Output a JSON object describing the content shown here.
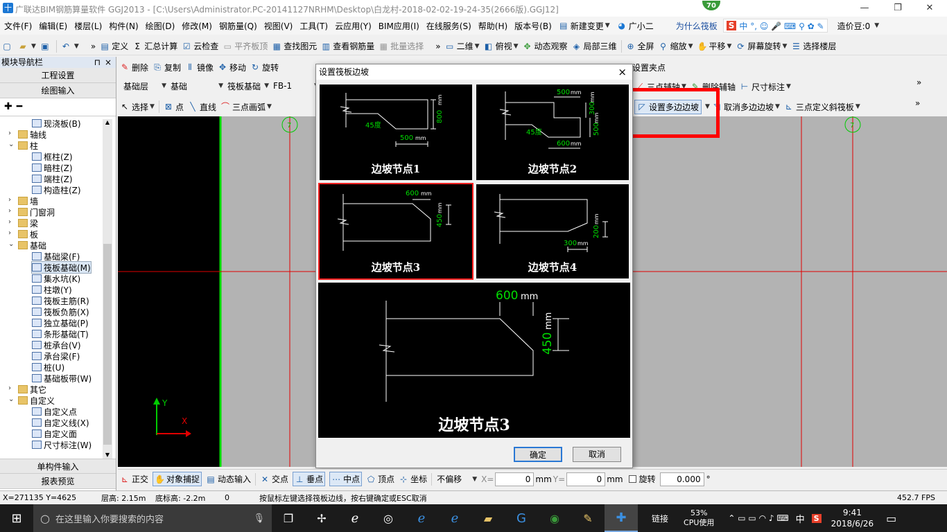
{
  "window": {
    "title": "广联达BIM钢筋算量软件 GGJ2013 - [C:\\Users\\Administrator.PC-20141127NRHM\\Desktop\\白龙村-2018-02-02-19-24-35(2666版).GGJ12]",
    "badge": "70"
  },
  "menu": [
    "文件(F)",
    "编辑(E)",
    "楼层(L)",
    "构件(N)",
    "绘图(D)",
    "修改(M)",
    "钢筋量(Q)",
    "视图(V)",
    "工具(T)",
    "云应用(Y)",
    "BIM应用(I)",
    "在线服务(S)",
    "帮助(H)",
    "版本号(B)",
    "新建变更",
    "广小二"
  ],
  "menu_right": {
    "question": "为什么筏板",
    "cost": "造价豆:0"
  },
  "toolbar1": {
    "items": [
      "定义",
      "汇总计算",
      "云检查",
      "平齐板顶",
      "查找图元",
      "查看钢筋量",
      "批量选择",
      "二维",
      "俯视",
      "动态观察",
      "局部三维",
      "全屏",
      "缩放",
      "平移",
      "屏幕旋转",
      "选择楼层"
    ]
  },
  "toolbar2": {
    "items": [
      "删除",
      "复制",
      "镜像",
      "移动",
      "旋转"
    ],
    "right_item": "设置夹点"
  },
  "toolbar3": {
    "floor": "基础层",
    "category": "基础",
    "type": "筏板基础",
    "name": "FB-1",
    "right_items": [
      "三点辅轴",
      "删除辅轴",
      "尺寸标注"
    ]
  },
  "toolbar4": {
    "items": [
      "选择",
      "点",
      "直线",
      "三点画弧"
    ],
    "right_items": [
      "设置多边边坡",
      "取消多边边坡",
      "三点定义斜筏板"
    ]
  },
  "leftpane": {
    "header": "模块导航栏",
    "pin": "⊓",
    "close": "×",
    "btn_project": "工程设置",
    "btn_drawing": "绘图输入",
    "tree": [
      {
        "label": "现浇板(B)",
        "kind": "leaf",
        "level": 2
      },
      {
        "label": "轴线",
        "kind": "folder",
        "level": 1,
        "exp": "+"
      },
      {
        "label": "柱",
        "kind": "folder",
        "level": 1,
        "exp": "-"
      },
      {
        "label": "框柱(Z)",
        "kind": "leaf",
        "level": 2
      },
      {
        "label": "暗柱(Z)",
        "kind": "leaf",
        "level": 2
      },
      {
        "label": "端柱(Z)",
        "kind": "leaf",
        "level": 2
      },
      {
        "label": "构造柱(Z)",
        "kind": "leaf",
        "level": 2
      },
      {
        "label": "墙",
        "kind": "folder",
        "level": 1,
        "exp": "+"
      },
      {
        "label": "门窗洞",
        "kind": "folder",
        "level": 1,
        "exp": "+"
      },
      {
        "label": "梁",
        "kind": "folder",
        "level": 1,
        "exp": "+"
      },
      {
        "label": "板",
        "kind": "folder",
        "level": 1,
        "exp": "+"
      },
      {
        "label": "基础",
        "kind": "folder",
        "level": 1,
        "exp": "-"
      },
      {
        "label": "基础梁(F)",
        "kind": "leaf",
        "level": 2
      },
      {
        "label": "筏板基础(M)",
        "kind": "leaf",
        "level": 2,
        "selected": true
      },
      {
        "label": "集水坑(K)",
        "kind": "leaf",
        "level": 2
      },
      {
        "label": "柱墩(Y)",
        "kind": "leaf",
        "level": 2
      },
      {
        "label": "筏板主筋(R)",
        "kind": "leaf",
        "level": 2
      },
      {
        "label": "筏板负筋(X)",
        "kind": "leaf",
        "level": 2
      },
      {
        "label": "独立基础(P)",
        "kind": "leaf",
        "level": 2
      },
      {
        "label": "条形基础(T)",
        "kind": "leaf",
        "level": 2
      },
      {
        "label": "桩承台(V)",
        "kind": "leaf",
        "level": 2
      },
      {
        "label": "承台梁(F)",
        "kind": "leaf",
        "level": 2
      },
      {
        "label": "桩(U)",
        "kind": "leaf",
        "level": 2
      },
      {
        "label": "基础板带(W)",
        "kind": "leaf",
        "level": 2
      },
      {
        "label": "其它",
        "kind": "folder",
        "level": 1,
        "exp": "+"
      },
      {
        "label": "自定义",
        "kind": "folder",
        "level": 1,
        "exp": "-"
      },
      {
        "label": "自定义点",
        "kind": "leaf",
        "level": 2
      },
      {
        "label": "自定义线(X)",
        "kind": "leaf",
        "level": 2
      },
      {
        "label": "自定义面",
        "kind": "leaf",
        "level": 2
      },
      {
        "label": "尺寸标注(W)",
        "kind": "leaf",
        "level": 2
      }
    ],
    "btn_single": "单构件输入",
    "btn_report": "报表预览"
  },
  "canvas": {
    "axis_y": "Y",
    "axis_x": "X",
    "axis_bubble": "7"
  },
  "dialog": {
    "title": "设置筏板边坡",
    "close": "×",
    "nodes": [
      {
        "label": "边坡节点1",
        "dim_a": "800",
        "unit_a": "mm",
        "dim_b": "500",
        "unit_b": "mm",
        "angle": "45度"
      },
      {
        "label": "边坡节点2",
        "dim_a": "500",
        "unit_a": "mm",
        "dim_b": "300",
        "unit_b": "mm",
        "dim_c": "500",
        "unit_c": "mm",
        "dim_d": "600",
        "unit_d": "mm",
        "angle": "45度"
      },
      {
        "label": "边坡节点3",
        "dim_a": "600",
        "unit_a": "mm",
        "dim_b": "450",
        "unit_b": "mm"
      },
      {
        "label": "边坡节点4",
        "dim_a": "200",
        "unit_a": "mm",
        "dim_b": "300",
        "unit_b": "mm"
      }
    ],
    "preview": {
      "label": "边坡节点3",
      "dim_a": "600",
      "unit_a": "mm",
      "dim_b": "450",
      "unit_b": "mm"
    },
    "ok": "确定",
    "cancel": "取消"
  },
  "snapbar": {
    "items": [
      "正交",
      "对象捕捉",
      "动态输入",
      "交点",
      "垂点",
      "中点",
      "顶点",
      "坐标"
    ],
    "offset": "不偏移",
    "x_label": "X=",
    "x_value": "0",
    "x_unit": "mm",
    "y_label": "Y=",
    "y_value": "0",
    "y_unit": "mm",
    "rotate_label": "旋转",
    "rotate_value": "0.000",
    "degree": "°"
  },
  "status": {
    "coords": "X=271135 Y=4625",
    "floor_height": "层高: 2.15m",
    "bottom_height": "底标高: -2.2m",
    "zero": "0",
    "hint": "按鼠标左键选择筏板边线，按右键确定或ESC取消",
    "fps": "452.7 FPS"
  },
  "taskbar": {
    "search": "在这里输入你要搜索的内容",
    "link": "链接",
    "cpu_pct": "53%",
    "cpu_label": "CPU使用",
    "ime": "中",
    "time": "9:41",
    "date": "2018/6/26"
  }
}
